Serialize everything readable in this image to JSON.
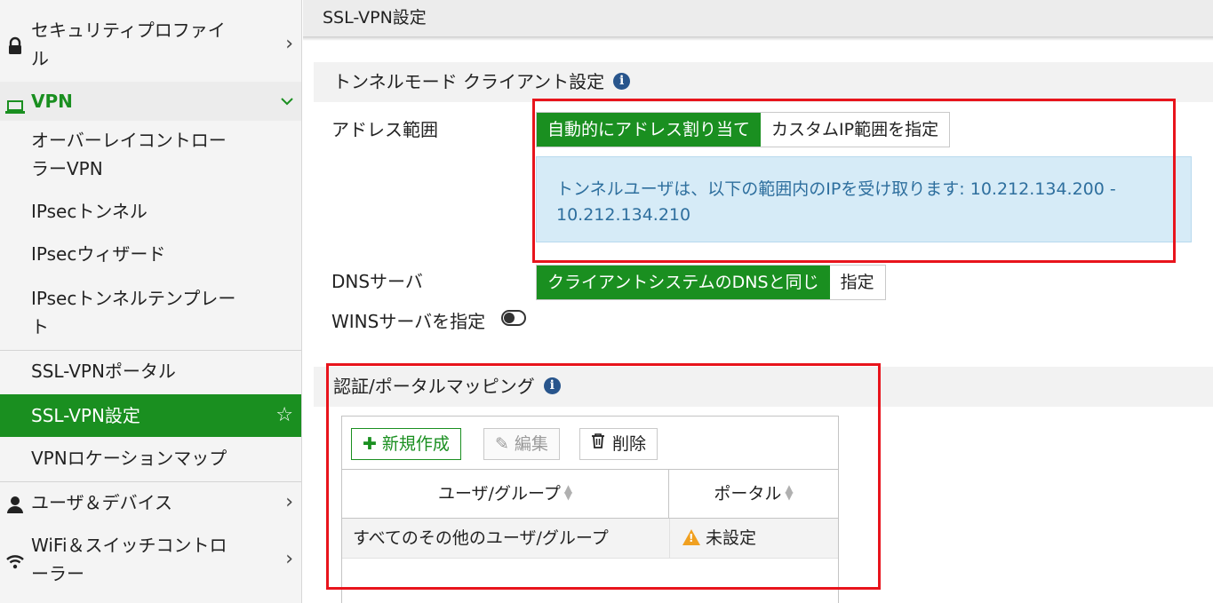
{
  "sidebar": {
    "items": [
      {
        "label": "セキュリティプロファイル"
      },
      {
        "label": "VPN"
      },
      {
        "label": "オーバーレイコントローラーVPN"
      },
      {
        "label": "IPsecトンネル"
      },
      {
        "label": "IPsecウィザード"
      },
      {
        "label": "IPsecトンネルテンプレート"
      },
      {
        "label": "SSL-VPNポータル"
      },
      {
        "label": "SSL-VPN設定"
      },
      {
        "label": "VPNロケーションマップ"
      },
      {
        "label": "ユーザ＆デバイス"
      },
      {
        "label": "WiFi＆スイッチコントローラー"
      }
    ],
    "lines": {
      "sec_line1": "セキュリティプロファイ",
      "sec_line2": "ル",
      "overlay_line1": "オーバーレイコントロー",
      "overlay_line2": "ラーVPN",
      "template_line1": "IPsecトンネルテンプレー",
      "template_line2": "ト",
      "wifi_line1": "WiFi＆スイッチコントロ",
      "wifi_line2": "ーラー"
    },
    "chevron_right": "›",
    "chevron_down": "⌄",
    "star": "☆"
  },
  "header": {
    "title": "SSL-VPN設定"
  },
  "tunnel_section": {
    "title": "トンネルモード クライアント設定",
    "info_glyph": "i",
    "address_label": "アドレス範囲",
    "address_options": [
      "自動的にアドレス割り当て",
      "カスタムIP範囲を指定"
    ],
    "address_selected": "自動的にアドレス割り当て",
    "notice_line1": "トンネルユーザは、以下の範囲内のIPを受け取ります: 10.212.134.200 -",
    "notice_line2": "10.212.134.210",
    "dns_label": "DNSサーバ",
    "dns_options": [
      "クライアントシステムのDNSと同じ",
      "指定"
    ],
    "dns_selected": "クライアントシステムのDNSと同じ",
    "wins_label": "WINSサーバを指定",
    "wins_enabled": false
  },
  "mapping_section": {
    "title": "認証/ポータルマッピング",
    "info_glyph": "i",
    "toolbar": {
      "new_label": "新規作成",
      "new_icon": "plus-icon",
      "new_glyph": "✚",
      "edit_label": "編集",
      "edit_icon": "pencil-icon",
      "edit_glyph": "✎",
      "delete_label": "削除",
      "delete_icon": "trash-icon"
    },
    "columns": [
      "ユーザ/グループ",
      "ポータル"
    ],
    "sort_glyph_up": "▲",
    "sort_glyph_down": "▼",
    "rows": [
      {
        "user_group": "すべてのその他のユーザ/グループ",
        "portal": "未設定",
        "portal_icon": "warning-icon"
      }
    ]
  },
  "colors": {
    "accent": "#1a8f20",
    "highlight_box": "#e8141c",
    "notice_bg": "#d6ebf7",
    "notice_text": "#2e6f9e"
  }
}
